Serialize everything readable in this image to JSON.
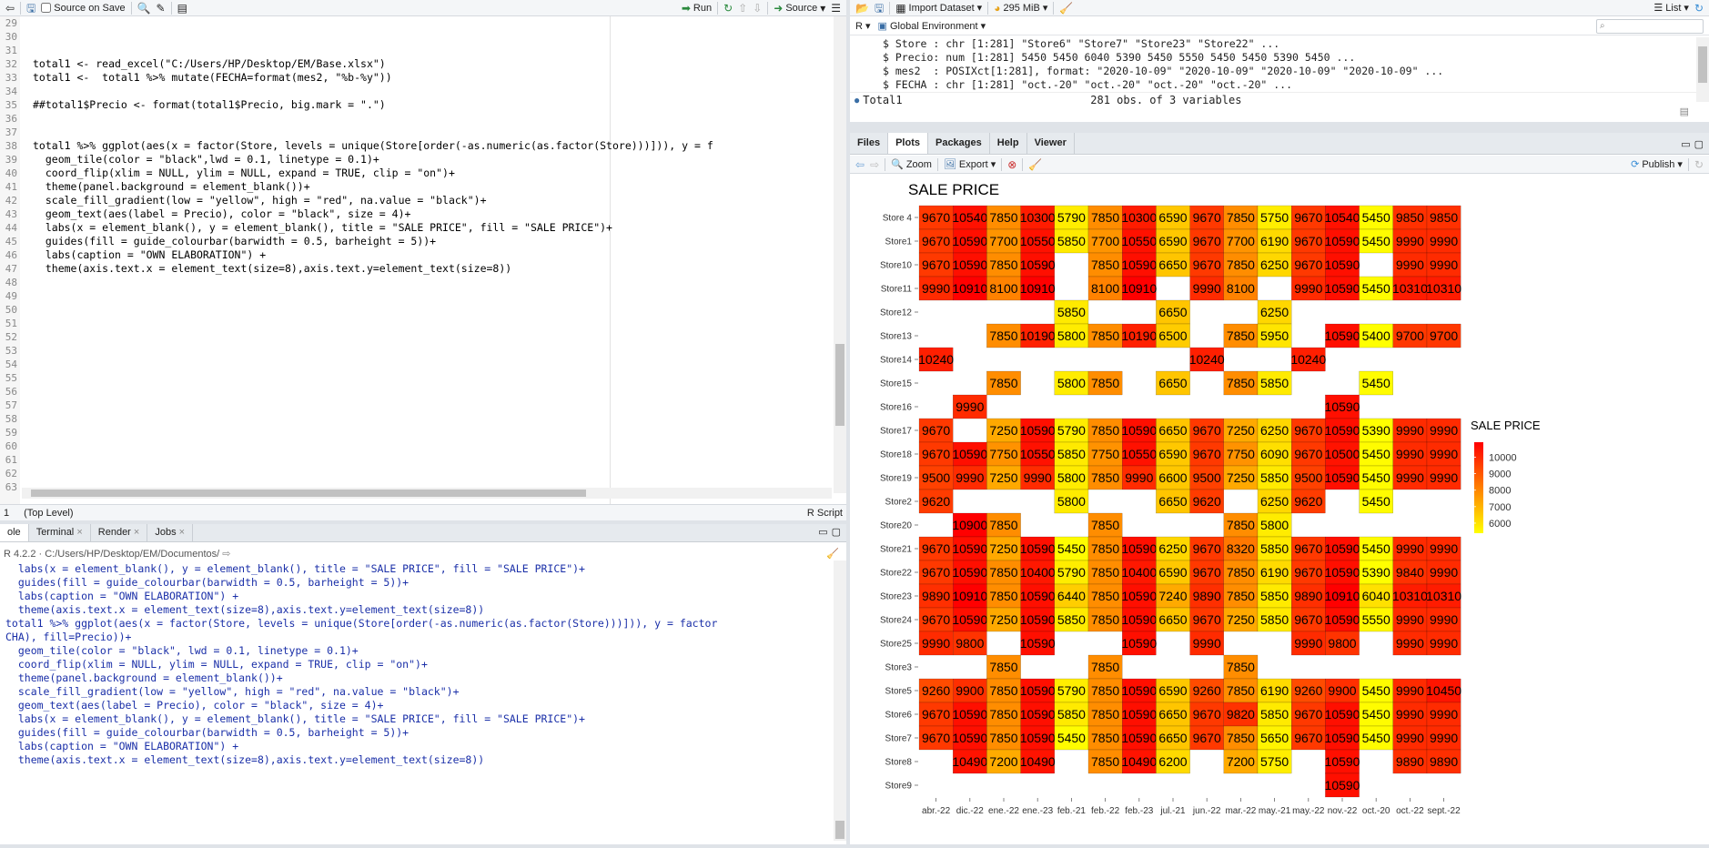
{
  "editor": {
    "toolbar": {
      "source_on_save": "Source on Save",
      "run": "Run",
      "source": "Source"
    },
    "line_numbers": [
      "29",
      "30",
      "31",
      "32",
      "33",
      "34",
      "35",
      "36",
      "37",
      "38",
      "39",
      "40",
      "41",
      "42",
      "43",
      "44",
      "45",
      "46",
      "47",
      "48",
      "49",
      "50",
      "51",
      "52",
      "53",
      "54",
      "55",
      "56",
      "57",
      "58",
      "59",
      "60",
      "61",
      "62",
      "63"
    ],
    "lines": [
      "",
      "",
      "",
      "total1 <- read_excel(\"C:/Users/HP/Desktop/EM/Base.xlsx\")",
      "total1 <-  total1 %>% mutate(FECHA=format(mes2, \"%b-%y\"))",
      "",
      "##total1$Precio <- format(total1$Precio, big.mark = \".\")",
      "",
      "",
      "total1 %>% ggplot(aes(x = factor(Store, levels = unique(Store[order(-as.numeric(as.factor(Store)))])), y = f",
      "  geom_tile(color = \"black\",lwd = 0.1, linetype = 0.1)+",
      "  coord_flip(xlim = NULL, ylim = NULL, expand = TRUE, clip = \"on\")+",
      "  theme(panel.background = element_blank())+",
      "  scale_fill_gradient(low = \"yellow\", high = \"red\", na.value = \"black\")+",
      "  geom_text(aes(label = Precio), color = \"black\", size = 4)+",
      "  labs(x = element_blank(), y = element_blank(), title = \"SALE PRICE\", fill = \"SALE PRICE\")+",
      "  guides(fill = guide_colourbar(barwidth = 0.5, barheight = 5))+",
      "  labs(caption = \"OWN ELABORATION\") +",
      "  theme(axis.text.x = element_text(size=8),axis.text.y=element_text(size=8))",
      "",
      "",
      "",
      "",
      "",
      "",
      "",
      "",
      "",
      "",
      "",
      "",
      "",
      "",
      "",
      ""
    ],
    "status": {
      "position": "1",
      "scope": "(Top Level)",
      "file_type": "R Script"
    }
  },
  "console": {
    "tabs": [
      "ole",
      "Terminal",
      "Render",
      "Jobs"
    ],
    "path": "R 4.2.2 · C:/Users/HP/Desktop/EM/Documentos/",
    "lines": [
      "  labs(x = element_blank(), y = element_blank(), title = \"SALE PRICE\", fill = \"SALE PRICE\")+",
      "  guides(fill = guide_colourbar(barwidth = 0.5, barheight = 5))+",
      "  labs(caption = \"OWN ELABORATION\") +",
      "  theme(axis.text.x = element_text(size=8),axis.text.y=element_text(size=8))",
      "total1 %>% ggplot(aes(x = factor(Store, levels = unique(Store[order(-as.numeric(as.factor(Store)))])), y = factor",
      "CHA), fill=Precio))+",
      "  geom_tile(color = \"black\", lwd = 0.1, linetype = 0.1)+",
      "  coord_flip(xlim = NULL, ylim = NULL, expand = TRUE, clip = \"on\")+",
      "  theme(panel.background = element_blank())+",
      "  scale_fill_gradient(low = \"yellow\", high = \"red\", na.value = \"black\")+",
      "  geom_text(aes(label = Precio), color = \"black\", size = 4)+",
      "  labs(x = element_blank(), y = element_blank(), title = \"SALE PRICE\", fill = \"SALE PRICE\")+",
      "  guides(fill = guide_colourbar(barwidth = 0.5, barheight = 5))+",
      "  labs(caption = \"OWN ELABORATION\") +",
      "  theme(axis.text.x = element_text(size=8),axis.text.y=element_text(size=8))"
    ]
  },
  "environment": {
    "toolbar": {
      "import_dataset": "Import Dataset",
      "memory": "295 MiB",
      "list": "List"
    },
    "r_label": "R",
    "scope": "Global Environment",
    "search_placeholder": "",
    "rows": [
      "$ Store : chr [1:281] \"Store6\" \"Store7\" \"Store23\" \"Store22\" ...",
      "$ Precio: num [1:281] 5450 5450 6040 5390 5450 5550 5450 5450 5390 5450 ...",
      "$ mes2  : POSIXct[1:281], format: \"2020-10-09\" \"2020-10-09\" \"2020-10-09\" \"2020-10-09\" ...",
      "$ FECHA : chr [1:281] \"oct.-20\" \"oct.-20\" \"oct.-20\" \"oct.-20\" ..."
    ],
    "object_name": "Total1",
    "object_desc": "281 obs. of 3 variables"
  },
  "files_pane": {
    "tabs": [
      "Files",
      "Plots",
      "Packages",
      "Help",
      "Viewer"
    ],
    "active_tab": "Plots",
    "toolbar": {
      "zoom": "Zoom",
      "export": "Export",
      "publish": "Publish"
    }
  },
  "chart_data": {
    "type": "heatmap",
    "title": "SALE PRICE",
    "caption": "OWN ELABORATION",
    "legend_title": "SALE PRICE",
    "legend_ticks": [
      10000,
      9000,
      8000,
      7000,
      6000
    ],
    "color_low": "#ffff00",
    "color_high": "#ff0000",
    "value_range": [
      5390,
      10910
    ],
    "x_categories": [
      "abr.-22",
      "dic.-22",
      "ene.-22",
      "ene.-23",
      "feb.-21",
      "feb.-22",
      "feb.-23",
      "jul.-21",
      "jun.-22",
      "mar.-22",
      "may.-21",
      "may.-22",
      "nov.-22",
      "oct.-20",
      "oct.-22",
      "sept.-22"
    ],
    "y_categories": [
      "Store 4",
      "Store1",
      "Store10",
      "Store11",
      "Store12",
      "Store13",
      "Store14",
      "Store15",
      "Store16",
      "Store17",
      "Store18",
      "Store19",
      "Store2",
      "Store20",
      "Store21",
      "Store22",
      "Store23",
      "Store24",
      "Store25",
      "Store3",
      "Store5",
      "Store6",
      "Store7",
      "Store8",
      "Store9"
    ],
    "values": [
      [
        9670,
        10540,
        7850,
        10300,
        5790,
        7850,
        10300,
        6590,
        9670,
        7850,
        5750,
        9670,
        10540,
        5450,
        9850,
        9850
      ],
      [
        9670,
        10590,
        7700,
        10550,
        5850,
        7700,
        10550,
        6590,
        9670,
        7700,
        6190,
        9670,
        10590,
        5450,
        9990,
        9990
      ],
      [
        9670,
        10590,
        7850,
        10590,
        null,
        7850,
        10590,
        6650,
        9670,
        7850,
        6250,
        9670,
        10590,
        null,
        9990,
        9990
      ],
      [
        9990,
        10910,
        8100,
        10910,
        null,
        8100,
        10910,
        null,
        9990,
        8100,
        null,
        9990,
        10590,
        5450,
        10310,
        10310
      ],
      [
        null,
        null,
        null,
        null,
        5850,
        null,
        null,
        6650,
        null,
        null,
        6250,
        null,
        null,
        null,
        null,
        null
      ],
      [
        null,
        null,
        7850,
        10190,
        5800,
        7850,
        10190,
        6500,
        null,
        7850,
        5950,
        null,
        10590,
        5400,
        9700,
        9700
      ],
      [
        10240,
        null,
        null,
        null,
        null,
        null,
        null,
        null,
        10240,
        null,
        null,
        10240,
        null,
        null,
        null,
        null
      ],
      [
        null,
        null,
        7850,
        null,
        5800,
        7850,
        null,
        6650,
        null,
        7850,
        5850,
        null,
        null,
        5450,
        null,
        null
      ],
      [
        null,
        9990,
        null,
        null,
        null,
        null,
        null,
        null,
        null,
        null,
        null,
        null,
        10590,
        null,
        null,
        null
      ],
      [
        9670,
        null,
        7250,
        10590,
        5790,
        7850,
        10590,
        6650,
        9670,
        7250,
        6250,
        9670,
        10590,
        5390,
        9990,
        9990
      ],
      [
        9670,
        10590,
        7750,
        10550,
        5850,
        7750,
        10550,
        6590,
        9670,
        7750,
        6090,
        9670,
        10500,
        5450,
        9990,
        9990
      ],
      [
        9500,
        9990,
        7250,
        9990,
        5800,
        7850,
        9990,
        6600,
        9500,
        7250,
        5850,
        9500,
        10590,
        5450,
        9990,
        9990
      ],
      [
        9620,
        null,
        null,
        null,
        5800,
        null,
        null,
        6650,
        9620,
        null,
        6250,
        9620,
        null,
        5450,
        null,
        null
      ],
      [
        null,
        10900,
        7850,
        null,
        null,
        7850,
        null,
        null,
        null,
        7850,
        5800,
        null,
        null,
        null,
        null,
        null
      ],
      [
        9670,
        10590,
        7250,
        10590,
        5450,
        7850,
        10590,
        6250,
        9670,
        8320,
        5850,
        9670,
        10590,
        5450,
        9990,
        9990
      ],
      [
        9670,
        10590,
        7850,
        10400,
        5790,
        7850,
        10400,
        6590,
        9670,
        7850,
        6190,
        9670,
        10590,
        5390,
        9840,
        9990
      ],
      [
        9890,
        10910,
        7850,
        10590,
        6440,
        7850,
        10590,
        7240,
        9890,
        7850,
        5850,
        9890,
        10910,
        6040,
        10310,
        10310
      ],
      [
        9670,
        10590,
        7250,
        10590,
        5850,
        7850,
        10590,
        6650,
        9670,
        7250,
        5850,
        9670,
        10590,
        5550,
        9990,
        9990
      ],
      [
        9990,
        9800,
        null,
        10590,
        null,
        null,
        10590,
        null,
        9990,
        null,
        null,
        9990,
        9800,
        null,
        9990,
        9990
      ],
      [
        null,
        null,
        7850,
        null,
        null,
        7850,
        null,
        null,
        null,
        7850,
        null,
        null,
        null,
        null,
        null,
        null
      ],
      [
        9260,
        9900,
        7850,
        10590,
        5790,
        7850,
        10590,
        6590,
        9260,
        7850,
        6190,
        9260,
        9900,
        5450,
        9990,
        10450
      ],
      [
        9670,
        10590,
        7850,
        10590,
        5850,
        7850,
        10590,
        6650,
        9670,
        9820,
        5850,
        9670,
        10590,
        5450,
        9990,
        9990
      ],
      [
        9670,
        10590,
        7850,
        10590,
        5450,
        7850,
        10590,
        6650,
        9670,
        7850,
        5650,
        9670,
        10590,
        5450,
        9990,
        9990
      ],
      [
        null,
        10490,
        7200,
        10490,
        null,
        7850,
        10490,
        6200,
        null,
        7200,
        5750,
        null,
        10590,
        null,
        9890,
        9890
      ],
      [
        null,
        null,
        null,
        null,
        null,
        null,
        null,
        null,
        null,
        null,
        null,
        null,
        10590,
        null,
        null,
        null
      ]
    ]
  }
}
